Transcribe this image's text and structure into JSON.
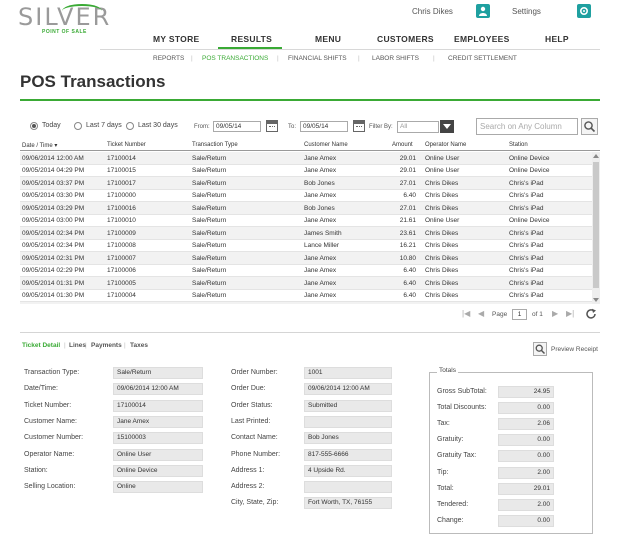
{
  "brand": {
    "name": "SILVER",
    "tagline": "POINT OF SALE"
  },
  "header": {
    "user": "Chris Dikes",
    "settings": "Settings"
  },
  "main_nav": [
    "MY STORE",
    "RESULTS",
    "MENU",
    "CUSTOMERS",
    "EMPLOYEES",
    "HELP"
  ],
  "sub_nav": [
    "REPORTS",
    "POS TRANSACTIONS",
    "FINANCIAL SHIFTS",
    "LABOR SHIFTS",
    "CREDIT SETTLEMENT"
  ],
  "page_title": "POS Transactions",
  "filters": {
    "today": "Today",
    "last7": "Last 7 days",
    "last30": "Last 30 days",
    "from_label": "From:",
    "from_value": "09/05/14",
    "to_label": "To:",
    "to_value": "09/05/14",
    "filter_by_label": "Filter By:",
    "filter_by_value": "All",
    "search_placeholder": "Search on Any Column"
  },
  "grid": {
    "headers": [
      "Date / Time",
      "Ticket Number",
      "Transaction Type",
      "Customer Name",
      "Amount",
      "Operator Name",
      "Station"
    ],
    "rows": [
      [
        "09/06/2014 12:00 AM",
        "17100014",
        "Sale/Return",
        "Jane Amex",
        "29.01",
        "Online User",
        "Online Device"
      ],
      [
        "09/05/2014 04:29 PM",
        "17100015",
        "Sale/Return",
        "Jane Amex",
        "29.01",
        "Online User",
        "Online Device"
      ],
      [
        "09/05/2014 03:37 PM",
        "17100017",
        "Sale/Return",
        "Bob Jones",
        "27.01",
        "Chris Dikes",
        "Chris's iPad"
      ],
      [
        "09/05/2014 03:30 PM",
        "17100000",
        "Sale/Return",
        "Jane Amex",
        "6.40",
        "Chris Dikes",
        "Chris's iPad"
      ],
      [
        "09/05/2014 03:29 PM",
        "17100016",
        "Sale/Return",
        "Bob Jones",
        "27.01",
        "Chris Dikes",
        "Chris's iPad"
      ],
      [
        "09/05/2014 03:00 PM",
        "17100010",
        "Sale/Return",
        "Jane Amex",
        "21.61",
        "Online User",
        "Online Device"
      ],
      [
        "09/05/2014 02:34 PM",
        "17100009",
        "Sale/Return",
        "James Smith",
        "23.61",
        "Chris Dikes",
        "Chris's iPad"
      ],
      [
        "09/05/2014 02:34 PM",
        "17100008",
        "Sale/Return",
        "Lance Miller",
        "16.21",
        "Chris Dikes",
        "Chris's iPad"
      ],
      [
        "09/05/2014 02:31 PM",
        "17100007",
        "Sale/Return",
        "Jane Amex",
        "10.80",
        "Chris Dikes",
        "Chris's iPad"
      ],
      [
        "09/05/2014 02:29 PM",
        "17100006",
        "Sale/Return",
        "Jane Amex",
        "6.40",
        "Chris Dikes",
        "Chris's iPad"
      ],
      [
        "09/05/2014 01:31 PM",
        "17100005",
        "Sale/Return",
        "Jane Amex",
        "6.40",
        "Chris Dikes",
        "Chris's iPad"
      ],
      [
        "09/05/2014 01:30 PM",
        "17100004",
        "Sale/Return",
        "Jane Amex",
        "6.40",
        "Chris Dikes",
        "Chris's iPad"
      ],
      [
        "09/05/2014 01:29 PM",
        "17100003",
        "Sale/Return",
        "Jane Amex",
        "6.40",
        "Chris Dikes",
        "Chris's iPad"
      ]
    ]
  },
  "pager": {
    "page_label": "Page",
    "page": "1",
    "of_label": "of 1"
  },
  "detail_tabs": [
    "Ticket Detail",
    "Lines",
    "Payments",
    "Taxes"
  ],
  "preview": "Preview Receipt",
  "ticket": {
    "left": [
      [
        "Transaction Type:",
        "Sale/Return"
      ],
      [
        "Date/Time:",
        "09/06/2014 12:00 AM"
      ],
      [
        "Ticket Number:",
        "17100014"
      ],
      [
        "Customer Name:",
        "Jane Amex"
      ],
      [
        "Customer Number:",
        "15100003"
      ],
      [
        "Operator Name:",
        "Online User"
      ],
      [
        "Station:",
        "Online Device"
      ],
      [
        "Selling Location:",
        "Online"
      ]
    ],
    "middle": [
      [
        "Order Number:",
        "1001"
      ],
      [
        "Order Due:",
        "09/06/2014 12:00 AM"
      ],
      [
        "Order Status:",
        "Submitted"
      ],
      [
        "Last Printed:",
        ""
      ],
      [
        "Contact Name:",
        "Bob Jones"
      ],
      [
        "Phone Number:",
        "817-555-6666"
      ],
      [
        "Address 1:",
        "4 Upside Rd."
      ],
      [
        "Address 2:",
        ""
      ],
      [
        "City, State, Zip:",
        "Fort Worth, TX, 76155"
      ]
    ]
  },
  "totals": {
    "legend": "Totals",
    "rows": [
      [
        "Gross SubTotal:",
        "24.95"
      ],
      [
        "Total Discounts:",
        "0.00"
      ],
      [
        "Tax:",
        "2.06"
      ],
      [
        "Gratuity:",
        "0.00"
      ],
      [
        "Gratuity Tax:",
        "0.00"
      ],
      [
        "Tip:",
        "2.00"
      ],
      [
        "Total:",
        "29.01"
      ],
      [
        "Tendered:",
        "2.00"
      ],
      [
        "Change:",
        "0.00"
      ]
    ]
  },
  "colors": {
    "accent": "#3aaa35",
    "icon_bg": "#1fa0a0"
  }
}
